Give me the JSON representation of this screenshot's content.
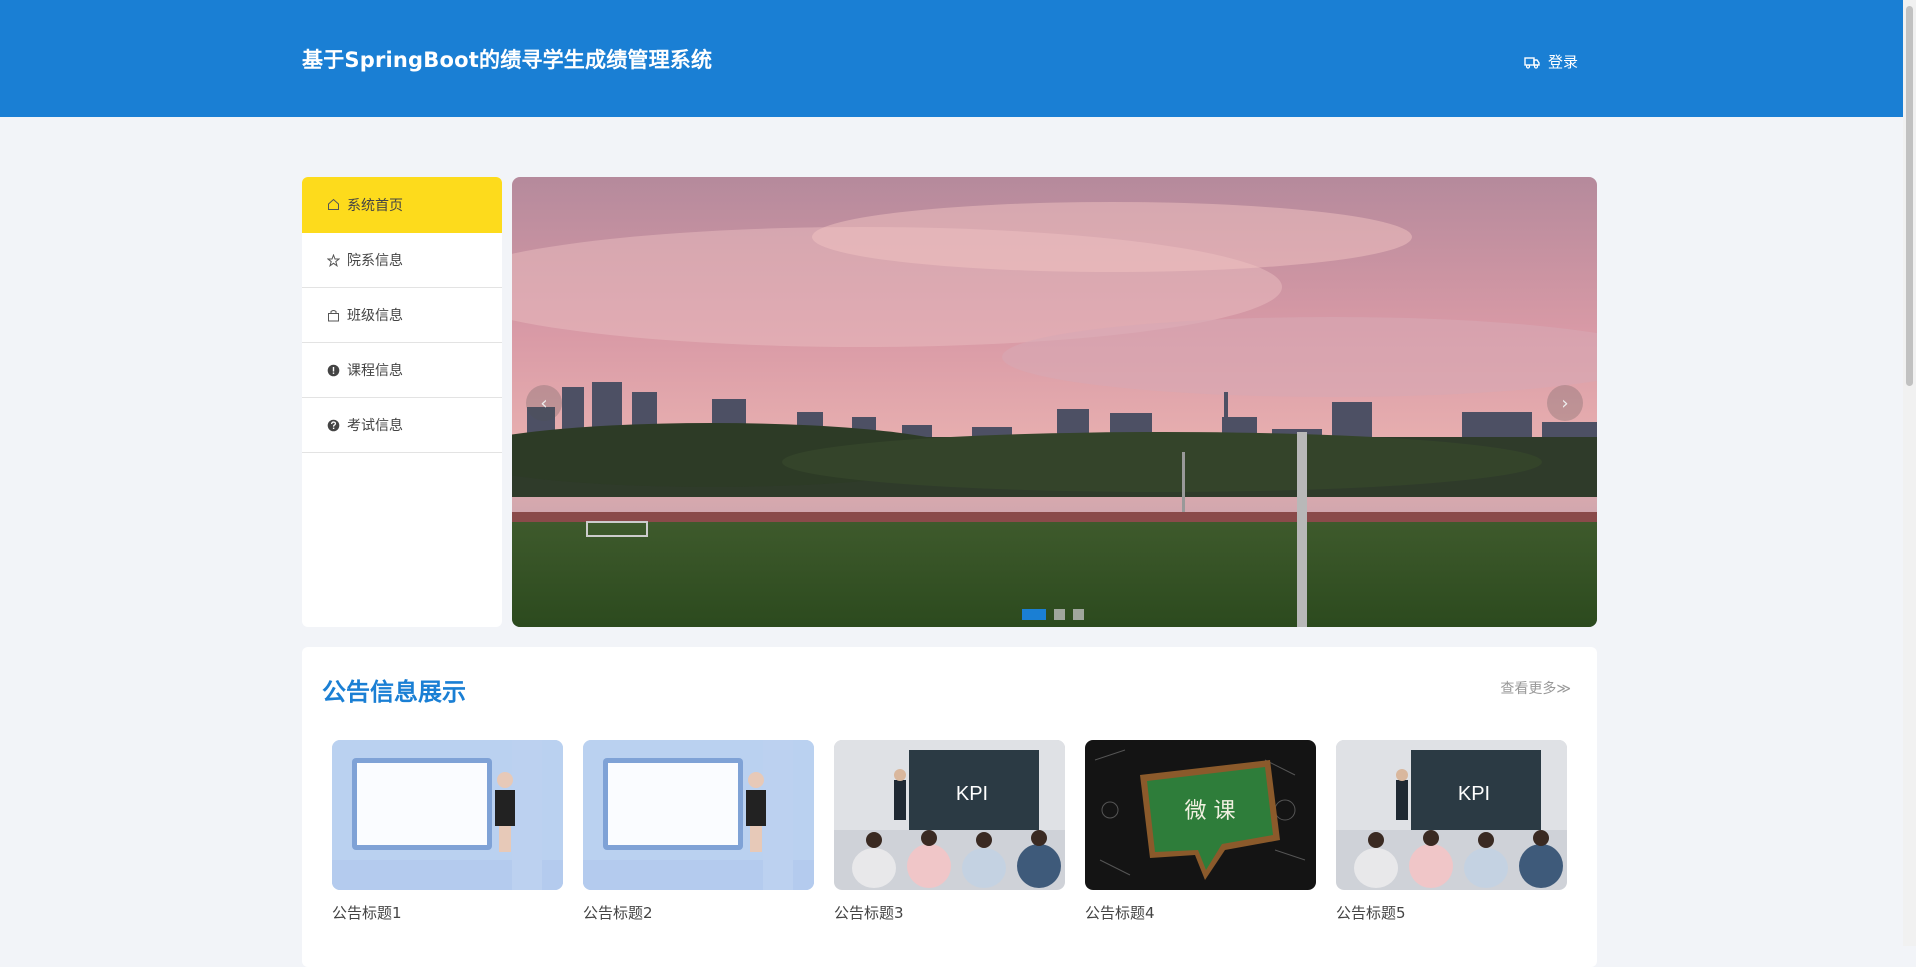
{
  "header": {
    "title": "基于SpringBoot的绩寻学生成绩管理系统",
    "login_label": "登录"
  },
  "sidebar": {
    "items": [
      {
        "label": "系统首页",
        "icon": "home-icon",
        "active": true
      },
      {
        "label": "院系信息",
        "icon": "star-icon"
      },
      {
        "label": "班级信息",
        "icon": "bag-icon"
      },
      {
        "label": "课程信息",
        "icon": "alert-circle-icon"
      },
      {
        "label": "考试信息",
        "icon": "question-circle-icon"
      }
    ]
  },
  "banner": {
    "active_slide": 1,
    "slide_count": 3
  },
  "notice": {
    "heading": "公告信息展示",
    "more_label": "查看更多≫",
    "cards": [
      {
        "title": "公告标题1",
        "thumb": "presenter-whiteboard"
      },
      {
        "title": "公告标题2",
        "thumb": "presenter-whiteboard"
      },
      {
        "title": "公告标题3",
        "thumb": "kpi-classroom",
        "thumb_text": "KPI"
      },
      {
        "title": "公告标题4",
        "thumb": "chalkboard-bubble",
        "thumb_text": "微 课"
      },
      {
        "title": "公告标题5",
        "thumb": "kpi-classroom",
        "thumb_text": "KPI"
      }
    ]
  },
  "colors": {
    "primary": "#1a7fd4",
    "active_menu": "#fddb1c",
    "background": "#f2f4f8"
  }
}
